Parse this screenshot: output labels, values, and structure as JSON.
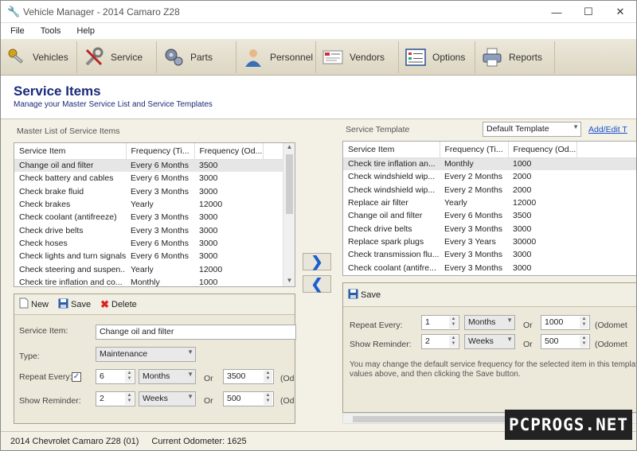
{
  "window": {
    "title": "Vehicle Manager - 2014 Camaro Z28",
    "minimize": "—",
    "maximize": "☐",
    "close": "✕"
  },
  "menu": [
    "File",
    "Tools",
    "Help"
  ],
  "toolbar": [
    {
      "label": "Vehicles",
      "icon": "keys-icon"
    },
    {
      "label": "Service",
      "icon": "wrench-icon"
    },
    {
      "label": "Parts",
      "icon": "gears-icon"
    },
    {
      "label": "Personnel",
      "icon": "person-icon"
    },
    {
      "label": "Vendors",
      "icon": "vendor-card-icon"
    },
    {
      "label": "Options",
      "icon": "options-icon"
    },
    {
      "label": "Reports",
      "icon": "printer-icon"
    }
  ],
  "header": {
    "title": "Service Items",
    "subtitle": "Manage your Master Service List and Service Templates"
  },
  "master": {
    "label": "Master List of Service Items",
    "columns": [
      "Service Item",
      "Frequency (Ti...",
      "Frequency (Od..."
    ],
    "rows": [
      [
        "Change oil and filter",
        "Every 6 Months",
        "3500"
      ],
      [
        "Check battery and cables",
        "Every 6 Months",
        "3000"
      ],
      [
        "Check brake fluid",
        "Every 3 Months",
        "3000"
      ],
      [
        "Check brakes",
        "Yearly",
        "12000"
      ],
      [
        "Check coolant (antifreeze)",
        "Every 3 Months",
        "3000"
      ],
      [
        "Check drive belts",
        "Every 3 Months",
        "3000"
      ],
      [
        "Check hoses",
        "Every 6 Months",
        "3000"
      ],
      [
        "Check lights and turn signals",
        "Every 6 Months",
        "3000"
      ],
      [
        "Check steering and suspen...",
        "Yearly",
        "12000"
      ],
      [
        "Check tire inflation and co...",
        "Monthly",
        "1000"
      ]
    ],
    "selected_row": 0
  },
  "template": {
    "label": "Service Template",
    "selected": "Default Template",
    "add_edit": "Add/Edit T",
    "columns": [
      "Service Item",
      "Frequency (Ti...",
      "Frequency (Od..."
    ],
    "rows": [
      [
        "Check tire inflation an...",
        "Monthly",
        "1000"
      ],
      [
        "Check windshield wip...",
        "Every 2 Months",
        "2000"
      ],
      [
        "Check windshield wip...",
        "Every 2 Months",
        "2000"
      ],
      [
        "Replace air filter",
        "Yearly",
        "12000"
      ],
      [
        "Change oil and filter",
        "Every 6 Months",
        "3500"
      ],
      [
        "Check drive belts",
        "Every 3 Months",
        "3000"
      ],
      [
        "Replace spark plugs",
        "Every 3 Years",
        "30000"
      ],
      [
        "Check transmission flu...",
        "Every 3 Months",
        "3000"
      ],
      [
        "Check coolant (antifre...",
        "Every 3 Months",
        "3000"
      ]
    ],
    "selected_row": 0
  },
  "arrows": {
    "add": "❯",
    "remove": "❮"
  },
  "editor": {
    "new_label": "New",
    "save_label": "Save",
    "delete_label": "Delete",
    "service_item_label": "Service Item:",
    "service_item_value": "Change oil and filter",
    "type_label": "Type:",
    "type_value": "Maintenance",
    "repeat_label": "Repeat Every:",
    "repeat_checked": "✓",
    "repeat_num": "6",
    "repeat_unit": "Months",
    "or": "Or",
    "repeat_odo": "3500",
    "odo_trunc": "(Od",
    "reminder_label": "Show Reminder:",
    "reminder_num": "2",
    "reminder_unit": "Weeks",
    "reminder_odo": "500"
  },
  "template_editor": {
    "save_label": "Save",
    "repeat_label": "Repeat Every:",
    "repeat_num": "1",
    "repeat_unit": "Months",
    "or": "Or",
    "repeat_odo": "1000",
    "odo_trunc": "(Odomet",
    "reminder_label": "Show Reminder:",
    "reminder_num": "2",
    "reminder_unit": "Weeks",
    "reminder_odo": "500",
    "info_line1": "You may change the default service frequency for the selected item in this template by",
    "info_line2": "values above, and then clicking the Save button."
  },
  "status": {
    "vehicle": "2014 Chevrolet Camaro Z28 (01)",
    "odometer": "Current Odometer: 1625"
  },
  "watermark": "PCPROGS.NET"
}
